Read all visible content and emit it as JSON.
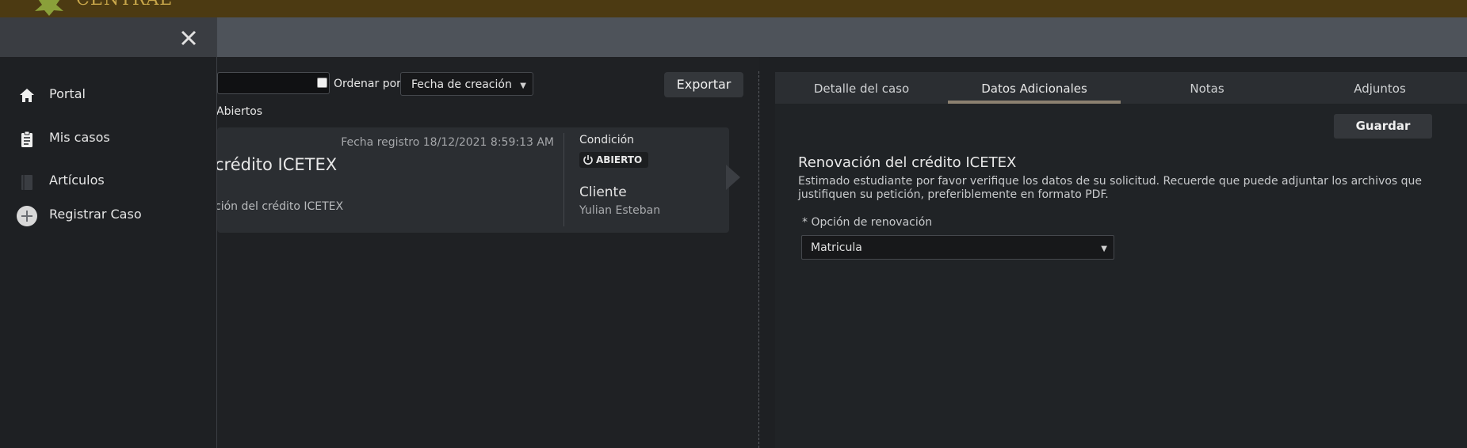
{
  "header": {
    "logo_text": "CENTRAL"
  },
  "toolbar": {
    "sort_label": "Ordenar por",
    "sort_value": "Fecha de creación",
    "export_label": "Exportar",
    "filter_label": "Abiertos"
  },
  "case": {
    "date": "Fecha registro 18/12/2021 8:59:13 AM",
    "title": "crédito ICETEX",
    "description": "ción del crédito ICETEX",
    "condition_label": "Condición",
    "status": "ABIERTO",
    "client_label": "Cliente",
    "client_name": "Yulian Esteban"
  },
  "detail": {
    "tabs": [
      {
        "label": "Detalle del caso",
        "active": false
      },
      {
        "label": "Datos Adicionales",
        "active": true
      },
      {
        "label": "Notas",
        "active": false
      },
      {
        "label": "Adjuntos",
        "active": false
      }
    ],
    "save_label": "Guardar",
    "title": "Renovación del crédito ICETEX",
    "description": "Estimado estudiante por favor verifique los datos de su solicitud. Recuerde que puede adjuntar los archivos que justifiquen su petición, preferiblemente en formato PDF.",
    "field_label": "* Opción de renovación",
    "field_value": "Matricula"
  },
  "nav": {
    "items": [
      {
        "label": "Portal",
        "icon": "home-icon"
      },
      {
        "label": "Mis casos",
        "icon": "clipboard-icon"
      },
      {
        "label": "Artículos",
        "icon": "book-icon"
      },
      {
        "label": "Registrar Caso",
        "icon": "plus-circle-icon"
      }
    ]
  },
  "colors": {
    "topbar": "#4c3a12",
    "accent_underline": "#8c8170",
    "background": "#1e2023"
  }
}
